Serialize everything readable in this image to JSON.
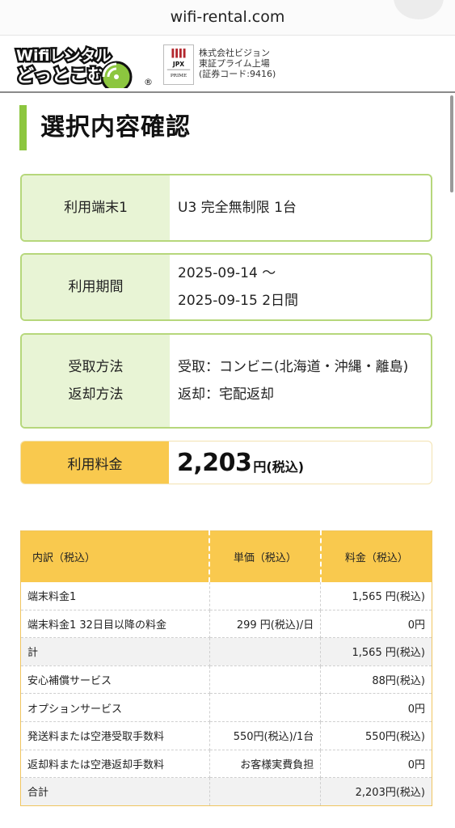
{
  "browser": {
    "url": "wifi-rental.com"
  },
  "header": {
    "logo_line1": "Wifiレンタル",
    "logo_line2": "どっとこむ",
    "registered": "®",
    "jpx_label": "JPX",
    "jpx_prime": "PRIME",
    "company_name": "株式会社ビジョン",
    "exchange": "東証プライム上場",
    "security_code": "(証券コード:9416)"
  },
  "page_title": "選択内容確認",
  "summary": {
    "device": {
      "label": "利用端末1",
      "value": "U3 完全無制限 1台"
    },
    "period": {
      "label": "利用期間",
      "value_line1": "2025-09-14 〜",
      "value_line2": "2025-09-15 2日間"
    },
    "method": {
      "label_line1": "受取方法",
      "label_line2": "返却方法",
      "receive": "受取：コンビニ(北海道・沖縄・離島)",
      "return": "返却：宅配返却"
    },
    "fee": {
      "label": "利用料金",
      "amount": "2,203",
      "suffix": "円(税込)"
    }
  },
  "breakdown": {
    "headers": [
      "内訳（税込）",
      "単価（税込）",
      "料金（税込）"
    ],
    "rows": [
      {
        "item": "端末料金1",
        "unit": "",
        "amount": "1,565 円(税込)",
        "shaded": false
      },
      {
        "item": "端末料金1 32日目以降の料金",
        "unit": "299 円(税込)/日",
        "amount": "0円",
        "shaded": false
      },
      {
        "item": "計",
        "unit": "",
        "amount": "1,565 円(税込)",
        "shaded": true
      },
      {
        "item": "安心補償サービス",
        "unit": "",
        "amount": "88円(税込)",
        "shaded": false
      },
      {
        "item": "オプションサービス",
        "unit": "",
        "amount": "0円",
        "shaded": false
      },
      {
        "item": "発送料または空港受取手数料",
        "unit": "550円(税込)/1台",
        "amount": "550円(税込)",
        "shaded": false
      },
      {
        "item": "返却料または空港返却手数料",
        "unit": "お客様実費負担",
        "amount": "0円",
        "shaded": false
      },
      {
        "item": "合計",
        "unit": "",
        "amount": "2,203円(税込)",
        "shaded": true
      }
    ]
  },
  "colors": {
    "accent_green": "#8cc63f",
    "label_green_bg": "#e8f4d5",
    "accent_yellow": "#f9c94e"
  }
}
